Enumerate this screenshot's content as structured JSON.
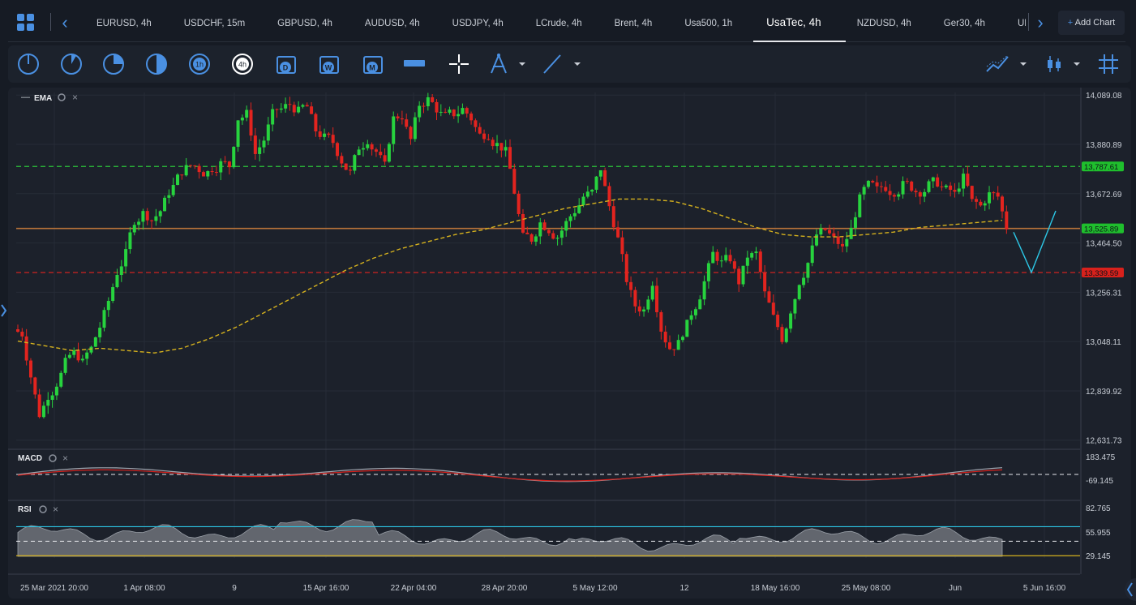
{
  "tabs": [
    {
      "label": "EURUSD, 4h"
    },
    {
      "label": "USDCHF, 15m"
    },
    {
      "label": "GBPUSD, 4h"
    },
    {
      "label": "AUDUSD, 4h"
    },
    {
      "label": "USDJPY, 4h"
    },
    {
      "label": "LCrude, 4h"
    },
    {
      "label": "Brent, 4h"
    },
    {
      "label": "Usa500, 1h"
    },
    {
      "label": "UsaTec, 4h",
      "active": true
    },
    {
      "label": "NZDUSD, 4h"
    },
    {
      "label": "Ger30, 4h"
    },
    {
      "label": "UK"
    }
  ],
  "add_chart_label": "Add Chart",
  "add_chart_icon": "plus-icon",
  "toolbar": {
    "timeframes": [
      "1m",
      "5m",
      "15m",
      "30m",
      "1h",
      "4h",
      "D",
      "W",
      "M"
    ],
    "active_timeframe": "4h"
  },
  "indicators": {
    "ema_label": "EMA",
    "macd_label": "MACD",
    "rsi_label": "RSI"
  },
  "colors": {
    "bull": "#27d33e",
    "bear": "#e3241f",
    "ema": "#d6b21e",
    "resistance": "#2bc33a",
    "support_red": "#e3241f",
    "mid_line": "#b9743a",
    "projection": "#2cc7e6"
  },
  "chart_data": [
    {
      "type": "candlestick",
      "title": "UsaTec, 4h",
      "y_ticks": [
        14089.08,
        13880.89,
        13672.69,
        13464.5,
        13256.31,
        13048.11,
        12839.92,
        12631.73
      ],
      "ylim": [
        12600,
        14100
      ],
      "x_ticks": [
        "25 Mar 2021 20:00",
        "1 Apr 08:00",
        "9",
        "15 Apr 16:00",
        "22 Apr 04:00",
        "28 Apr 20:00",
        "5 May 12:00",
        "12",
        "18 May 16:00",
        "25 May 08:00",
        "Jun",
        "5 Jun 16:00"
      ],
      "horizontal_levels": [
        {
          "value": 13787.61,
          "label": "13,787.61",
          "color": "green",
          "style": "dashed"
        },
        {
          "value": 13525.89,
          "label": "13,525.89",
          "color": "green",
          "style": "solid"
        },
        {
          "value": 13339.59,
          "label": "13,339.59",
          "color": "red",
          "style": "dashed"
        }
      ],
      "close_path": [
        13080,
        12900,
        12740,
        12820,
        12870,
        12960,
        13000,
        12960,
        13020,
        13110,
        13220,
        13340,
        13420,
        13560,
        13590,
        13560,
        13600,
        13680,
        13740,
        13780,
        13790,
        13760,
        13780,
        13800,
        13790,
        13990,
        14010,
        13840,
        13900,
        14010,
        14030,
        14050,
        14020,
        14040,
        13940,
        13910,
        13890,
        13810,
        13760,
        13870,
        13900,
        13850,
        13790,
        13990,
        14000,
        13900,
        14050,
        14070,
        14030,
        14000,
        14010,
        14030,
        13990,
        13920,
        13920,
        13880,
        13850,
        13680,
        13490,
        13480,
        13550,
        13520,
        13490,
        13550,
        13600,
        13660,
        13680,
        13780,
        13620,
        13480,
        13310,
        13200,
        13180,
        13300,
        13100,
        13020,
        13040,
        13120,
        13200,
        13300,
        13420,
        13380,
        13400,
        13300,
        13410,
        13420,
        13250,
        13150,
        13060,
        13180,
        13300,
        13380,
        13500,
        13520,
        13480,
        13440,
        13520,
        13650,
        13710,
        13690,
        13700,
        13680,
        13710,
        13700,
        13680,
        13710,
        13720,
        13690,
        13670,
        13740,
        13640,
        13620,
        13670,
        13660,
        13530
      ],
      "ema_path": [
        13050,
        13030,
        13010,
        13020,
        13010,
        13000,
        13020,
        13060,
        13110,
        13170,
        13230,
        13290,
        13350,
        13400,
        13440,
        13470,
        13500,
        13520,
        13550,
        13580,
        13610,
        13630,
        13650,
        13650,
        13640,
        13610,
        13570,
        13530,
        13500,
        13490,
        13490,
        13500,
        13510,
        13530,
        13540,
        13550,
        13560
      ],
      "projection": [
        13510,
        13340,
        13600
      ],
      "macd": {
        "ylim": [
          -69.145,
          183.475
        ],
        "ticks": [
          183.475,
          -69.145
        ]
      },
      "rsi": {
        "ylim": [
          29.145,
          82.765
        ],
        "ticks": [
          82.765,
          55.955,
          29.145
        ],
        "levels": [
          70,
          50,
          30
        ]
      }
    }
  ]
}
